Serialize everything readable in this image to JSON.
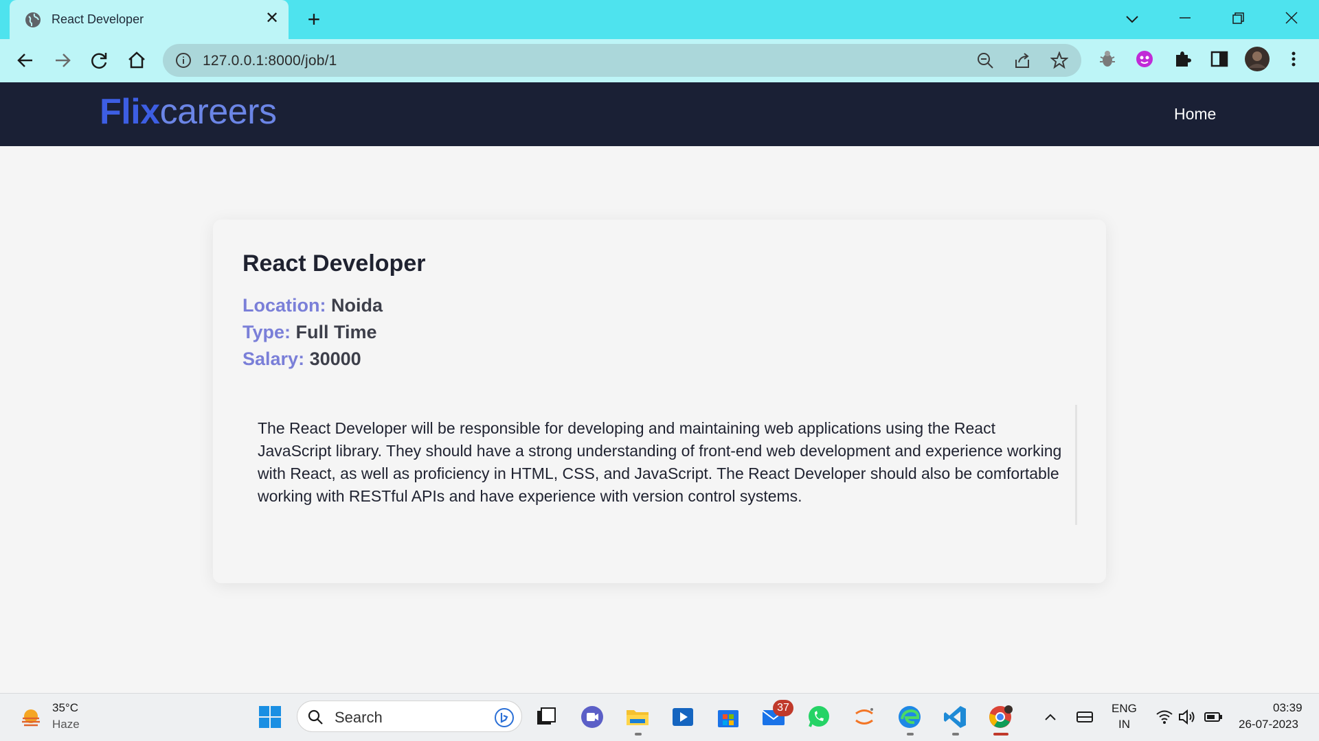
{
  "browser": {
    "tab_title": "React Developer",
    "tab_close": "✕",
    "new_tab": "+",
    "url": "127.0.0.1:8000/job/1"
  },
  "site": {
    "logo_part1": "Flix",
    "logo_part2": "careers",
    "nav_home": "Home"
  },
  "job": {
    "title": "React Developer",
    "location_label": "Location:",
    "location": "Noida",
    "type_label": "Type:",
    "type": "Full Time",
    "salary_label": "Salary:",
    "salary": "30000",
    "description": "The React Developer will be responsible for developing and maintaining web applications using the React JavaScript library. They should have a strong understanding of front-end web development and experience working with React, as well as proficiency in HTML, CSS, and JavaScript. The React Developer should also be comfortable working with RESTful APIs and have experience with version control systems."
  },
  "taskbar": {
    "weather_temp": "35°C",
    "weather_condition": "Haze",
    "search_placeholder": "Search",
    "mail_badge": "37",
    "language": "ENG",
    "region": "IN",
    "time": "03:39",
    "date": "26-07-2023"
  },
  "colors": {
    "tab_strip": "#4ee3ee",
    "toolbar": "#bdf5f7",
    "site_header": "#1a2035",
    "logo_primary": "#3d5ee3",
    "label_accent": "#7a7fd8"
  }
}
